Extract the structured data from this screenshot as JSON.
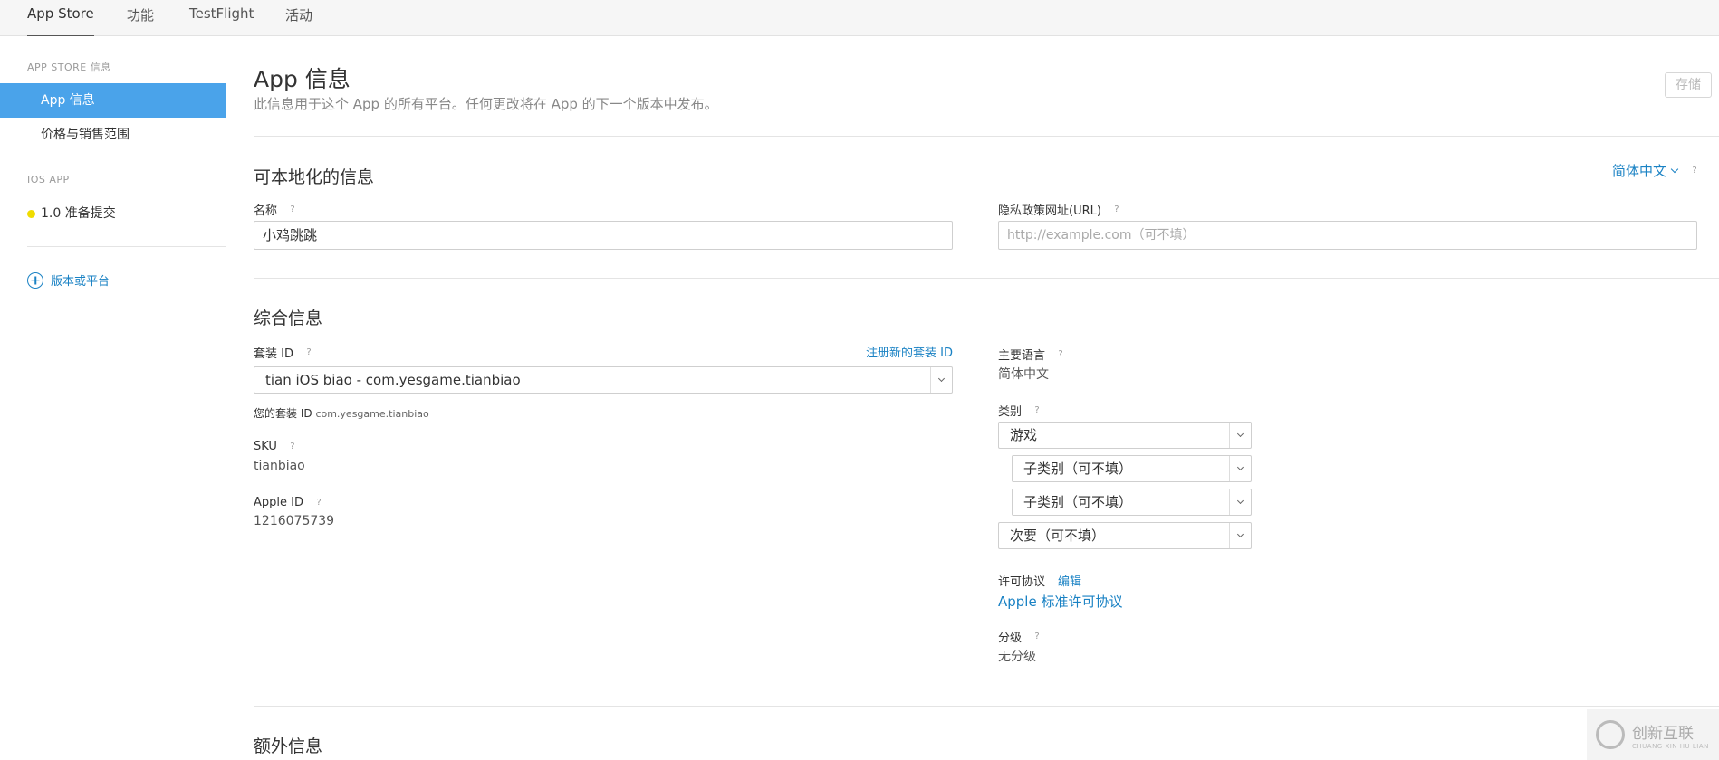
{
  "topnav": {
    "tabs": [
      "App Store",
      "功能",
      "TestFlight",
      "活动"
    ]
  },
  "sidebar": {
    "section1": "APP STORE 信息",
    "items1": [
      "App 信息",
      "价格与销售范围"
    ],
    "section2": "IOS APP",
    "version_item": "1.0 准备提交",
    "add_platform": "版本或平台"
  },
  "header": {
    "title": "App 信息",
    "subtitle": "此信息用于这个 App 的所有平台。任何更改将在 App 的下一个版本中发布。",
    "save_label": "存储"
  },
  "localizable": {
    "title": "可本地化的信息",
    "language": "简体中文",
    "name_label": "名称",
    "name_value": "小鸡跳跳",
    "privacy_label": "隐私政策网址(URL)",
    "privacy_placeholder": "http://example.com（可不填）"
  },
  "general": {
    "title": "综合信息",
    "bundle_label": "套装 ID",
    "register_link": "注册新的套装 ID",
    "bundle_value": "tian iOS biao - com.yesgame.tianbiao",
    "your_bundle_prefix": "您的套装 ID",
    "your_bundle_value": "com.yesgame.tianbiao",
    "sku_label": "SKU",
    "sku_value": "tianbiao",
    "apple_id_label": "Apple ID",
    "apple_id_value": "1216075739",
    "primary_lang_label": "主要语言",
    "primary_lang_value": "简体中文",
    "category_label": "类别",
    "category_primary": "游戏",
    "subcategory1": "子类别（可不填）",
    "subcategory2": "子类别（可不填）",
    "secondary": "次要（可不填）",
    "license_label": "许可协议",
    "license_edit": "编辑",
    "license_value": "Apple 标准许可协议",
    "rating_label": "分级",
    "rating_value": "无分级"
  },
  "extra": {
    "title": "额外信息"
  },
  "watermark": {
    "main": "创新互联",
    "sub": "CHUANG XIN HU LIAN"
  },
  "icons": {
    "help": "question-mark-icon",
    "chevron": "chevron-down-icon",
    "add": "plus-circle-icon"
  },
  "colors": {
    "accent": "#1a82c4",
    "sidebar_active": "#4aa3ea",
    "status_dot": "#f0dc00"
  }
}
